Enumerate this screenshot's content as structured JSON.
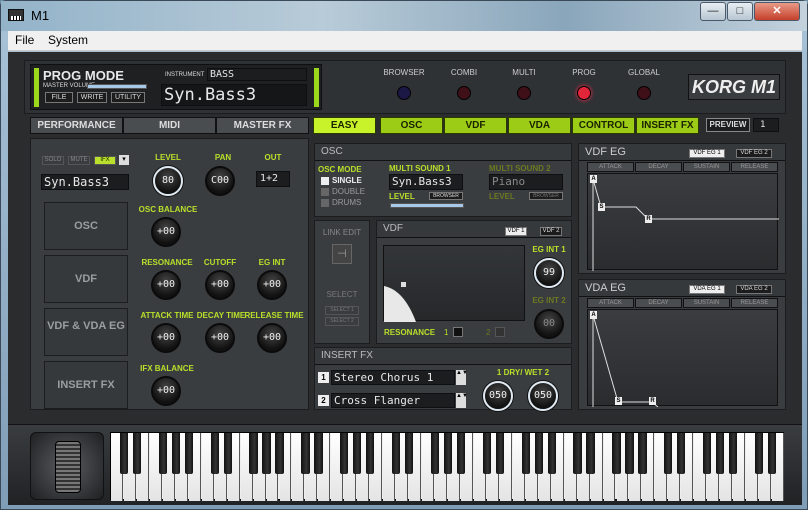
{
  "window": {
    "title": "M1",
    "minimize": "—",
    "maximize": "□",
    "close": "✕"
  },
  "menu": {
    "file": "File",
    "system": "System"
  },
  "prog": {
    "mode": "PROG MODE",
    "master_volume": "MASTER VOLUME",
    "file": "FILE",
    "write": "WRITE",
    "utility": "UTILITY",
    "instrument_label": "INSTRUMENT",
    "instrument_category": "BASS",
    "program_name": "Syn.Bass3"
  },
  "modes": {
    "browser": "BROWSER",
    "combi": "COMBI",
    "multi": "MULTI",
    "prog": "PROG",
    "global": "GLOBAL"
  },
  "brand": "KORG M1",
  "colors": {
    "accent": "#b9e02a",
    "prog_led": "#e2263a",
    "led_dim": "#3a1020",
    "browser_led": "#1a1640"
  },
  "left_tabs": {
    "performance": "PERFORMANCE",
    "midi": "MIDI",
    "master_fx": "MASTER FX"
  },
  "right_tabs": {
    "easy": "EASY",
    "osc": "OSC",
    "vdf": "VDF",
    "vda": "VDA",
    "control": "CONTROL",
    "insert_fx": "INSERT FX"
  },
  "preview": {
    "label": "PREVIEW",
    "value": "1"
  },
  "perf": {
    "solo": "SOLO",
    "mute": "MUTE",
    "ifx": "IFX",
    "name": "Syn.Bass3",
    "level_label": "LEVEL",
    "level": "80",
    "pan_label": "PAN",
    "pan": "C00",
    "out_label": "OUT",
    "out": "1+2",
    "osc": "OSC",
    "osc_balance_label": "OSC BALANCE",
    "osc_balance": "+00",
    "vdf": "VDF",
    "resonance_label": "RESONANCE",
    "resonance": "+00",
    "cutoff_label": "CUTOFF",
    "cutoff": "+00",
    "eg_int_label": "EG INT",
    "eg_int": "+00",
    "vdfvda": "VDF & VDA EG",
    "attack_label": "ATTACK TIME",
    "attack": "+00",
    "decay_label": "DECAY TIME",
    "decay": "+00",
    "release_label": "RELEASE TIME",
    "release": "+00",
    "insertfx": "INSERT FX",
    "ifx_balance_label": "IFX BALANCE",
    "ifx_balance": "+00"
  },
  "osc": {
    "header": "OSC",
    "mode_label": "OSC MODE",
    "single": "SINGLE",
    "double": "DOUBLE",
    "drums": "DRUMS",
    "ms1_label": "MULTI SOUND 1",
    "ms1": "Syn.Bass3",
    "level_label": "LEVEL",
    "browser": "BROWSER",
    "ms2_label": "MULTI SOUND 2",
    "ms2": "Piano",
    "level2_label": "LEVEL",
    "browser2": "BROWSER"
  },
  "link": {
    "link_edit": "LINK EDIT",
    "select": "SELECT",
    "select1": "SELECT 1",
    "select2": "SELECT 2"
  },
  "vdf": {
    "header": "VDF",
    "vdf1": "VDF 1",
    "vdf2": "VDF 2",
    "eg_int1_label": "EG INT 1",
    "eg_int1": "99",
    "eg_int2_label": "EG INT 2",
    "eg_int2": "00",
    "resonance_label": "RESONANCE",
    "res1": "1",
    "res2": "2"
  },
  "insertfx": {
    "header": "INSERT FX",
    "num1": "1",
    "fx1": "Stereo Chorus 1",
    "num2": "2",
    "fx2": "Cross Flanger",
    "drywet_label": "1 DRY/ WET 2",
    "dw1": "050",
    "dw2": "050"
  },
  "vdfeg": {
    "header": "VDF EG",
    "eg1": "VDF EG 1",
    "eg2": "VDF EG 2",
    "cols": [
      "ATTACK",
      "DECAY",
      "SUSTAIN",
      "RELEASE"
    ],
    "points": [
      "A",
      "S",
      "R"
    ]
  },
  "vdaeg": {
    "header": "VDA EG",
    "eg1": "VDA EG 1",
    "eg2": "VDA EG 2",
    "cols": [
      "ATTACK",
      "DECAY",
      "SUSTAIN",
      "RELEASE"
    ],
    "points": [
      "A",
      "S",
      "R"
    ]
  },
  "keyboard": {
    "white_keys": 52,
    "first_black_pattern": [
      1,
      1,
      0,
      1,
      1,
      1,
      0
    ]
  }
}
